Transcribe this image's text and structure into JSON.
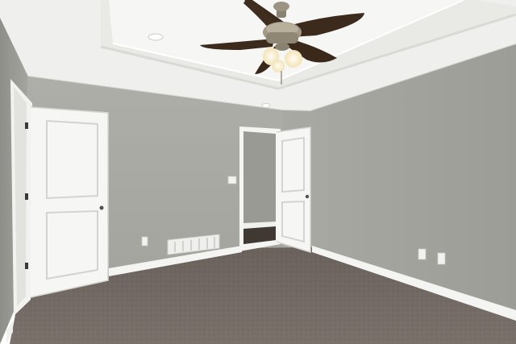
{
  "scene": {
    "subject": "empty-bedroom-interior",
    "colors": {
      "ceiling": "#f3f3f1",
      "tray_ceiling": "#f7f7f5",
      "wall_back": "#a9a9a3",
      "wall_right": "#a3a39d",
      "wall_left": "#9e9e98",
      "carpet": "#6e6560",
      "trim": "#f4f4f2",
      "door": "#f5f5f3",
      "fan_metal": "#8a8270",
      "fan_blade": "#3c2a1c",
      "light": "#fff7df"
    },
    "objects": [
      "ceiling-fan",
      "tray-ceiling",
      "recessed-light",
      "open-door-left",
      "open-doorway-center",
      "floor-vent",
      "electrical-outlet",
      "baseboard",
      "carpet"
    ]
  }
}
